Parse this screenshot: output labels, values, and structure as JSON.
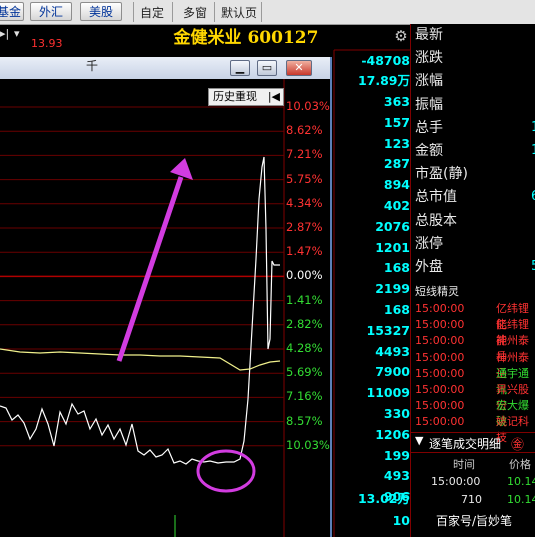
{
  "toolbar": {
    "buttons": [
      "基金",
      "外汇",
      "美股"
    ],
    "tabs": [
      "自定",
      "多窗",
      "默认页"
    ]
  },
  "stock": {
    "title": "金健米业 600127",
    "price_label": "13.93"
  },
  "chart_window": {
    "title_partial": "千",
    "history_button": "历史重现",
    "title_buttons": {
      "minimize": "▁",
      "restore": "▭",
      "close": "✕"
    }
  },
  "percent_labels_up": [
    "10.03%",
    "8.62%",
    "7.21%",
    "5.75%",
    "4.34%",
    "2.87%",
    "1.47%"
  ],
  "percent_label_zero": "0.00%",
  "percent_labels_down": [
    "1.41%",
    "2.82%",
    "4.28%",
    "5.69%",
    "7.16%",
    "8.57%",
    "10.03%"
  ],
  "side_column": {
    "top_values": [
      "-48708",
      "17.89万"
    ],
    "values": [
      "363",
      "157",
      "123",
      "287",
      "894",
      "402",
      "2076",
      "1201",
      "168",
      "2199",
      "168",
      "15327",
      "4493",
      "7900",
      "11009",
      "330",
      "1206",
      "199",
      "493",
      "906"
    ],
    "bottom_values": [
      "13.02万",
      "10"
    ]
  },
  "stats_labels": [
    "最新",
    "涨跌",
    "涨幅",
    "振幅",
    "总手",
    "金额",
    "市盈(静)",
    "总市值",
    "总股本",
    "涨停",
    "外盘"
  ],
  "stats_values": [
    "",
    "",
    "",
    "",
    "1",
    "1",
    "",
    "6",
    "",
    "",
    "5"
  ],
  "quick_wizard": {
    "title": "短线精灵",
    "rows": [
      {
        "time": "15:00:00",
        "name": "亿纬锂能",
        "color": "#ff3232"
      },
      {
        "time": "15:00:00",
        "name": "亿纬锂能",
        "color": "#ff3232"
      },
      {
        "time": "15:00:00",
        "name": "神州泰岳",
        "color": "#ff3232"
      },
      {
        "time": "15:00:00",
        "name": "神州泰岳",
        "color": "#ff3232"
      },
      {
        "time": "15:00:00",
        "name": "通宇通讯",
        "color": "#33dd33"
      },
      {
        "time": "15:00:00",
        "name": "昇兴股份",
        "color": "#ff3232"
      },
      {
        "time": "15:00:00",
        "name": "宏大爆破",
        "color": "#33dd33"
      },
      {
        "time": "15:00:00",
        "name": "姚记科技",
        "color": "#ff3232"
      }
    ]
  },
  "trade_detail": {
    "title": "逐笔成交明细",
    "badge": "㊎",
    "col_time": "时间",
    "col_price": "价格",
    "rows": [
      {
        "time": "15:00:00",
        "price": "10.14"
      },
      {
        "time": "",
        "vol": "710",
        "price": "10.14"
      }
    ]
  },
  "watermark": "百家号/旨妙笔",
  "colors": {
    "up": "#ff3232",
    "down": "#33dd33",
    "highlight": "#00ffff",
    "title_gold": "#ffd700",
    "annotation_magenta": "#d23ce0"
  }
}
